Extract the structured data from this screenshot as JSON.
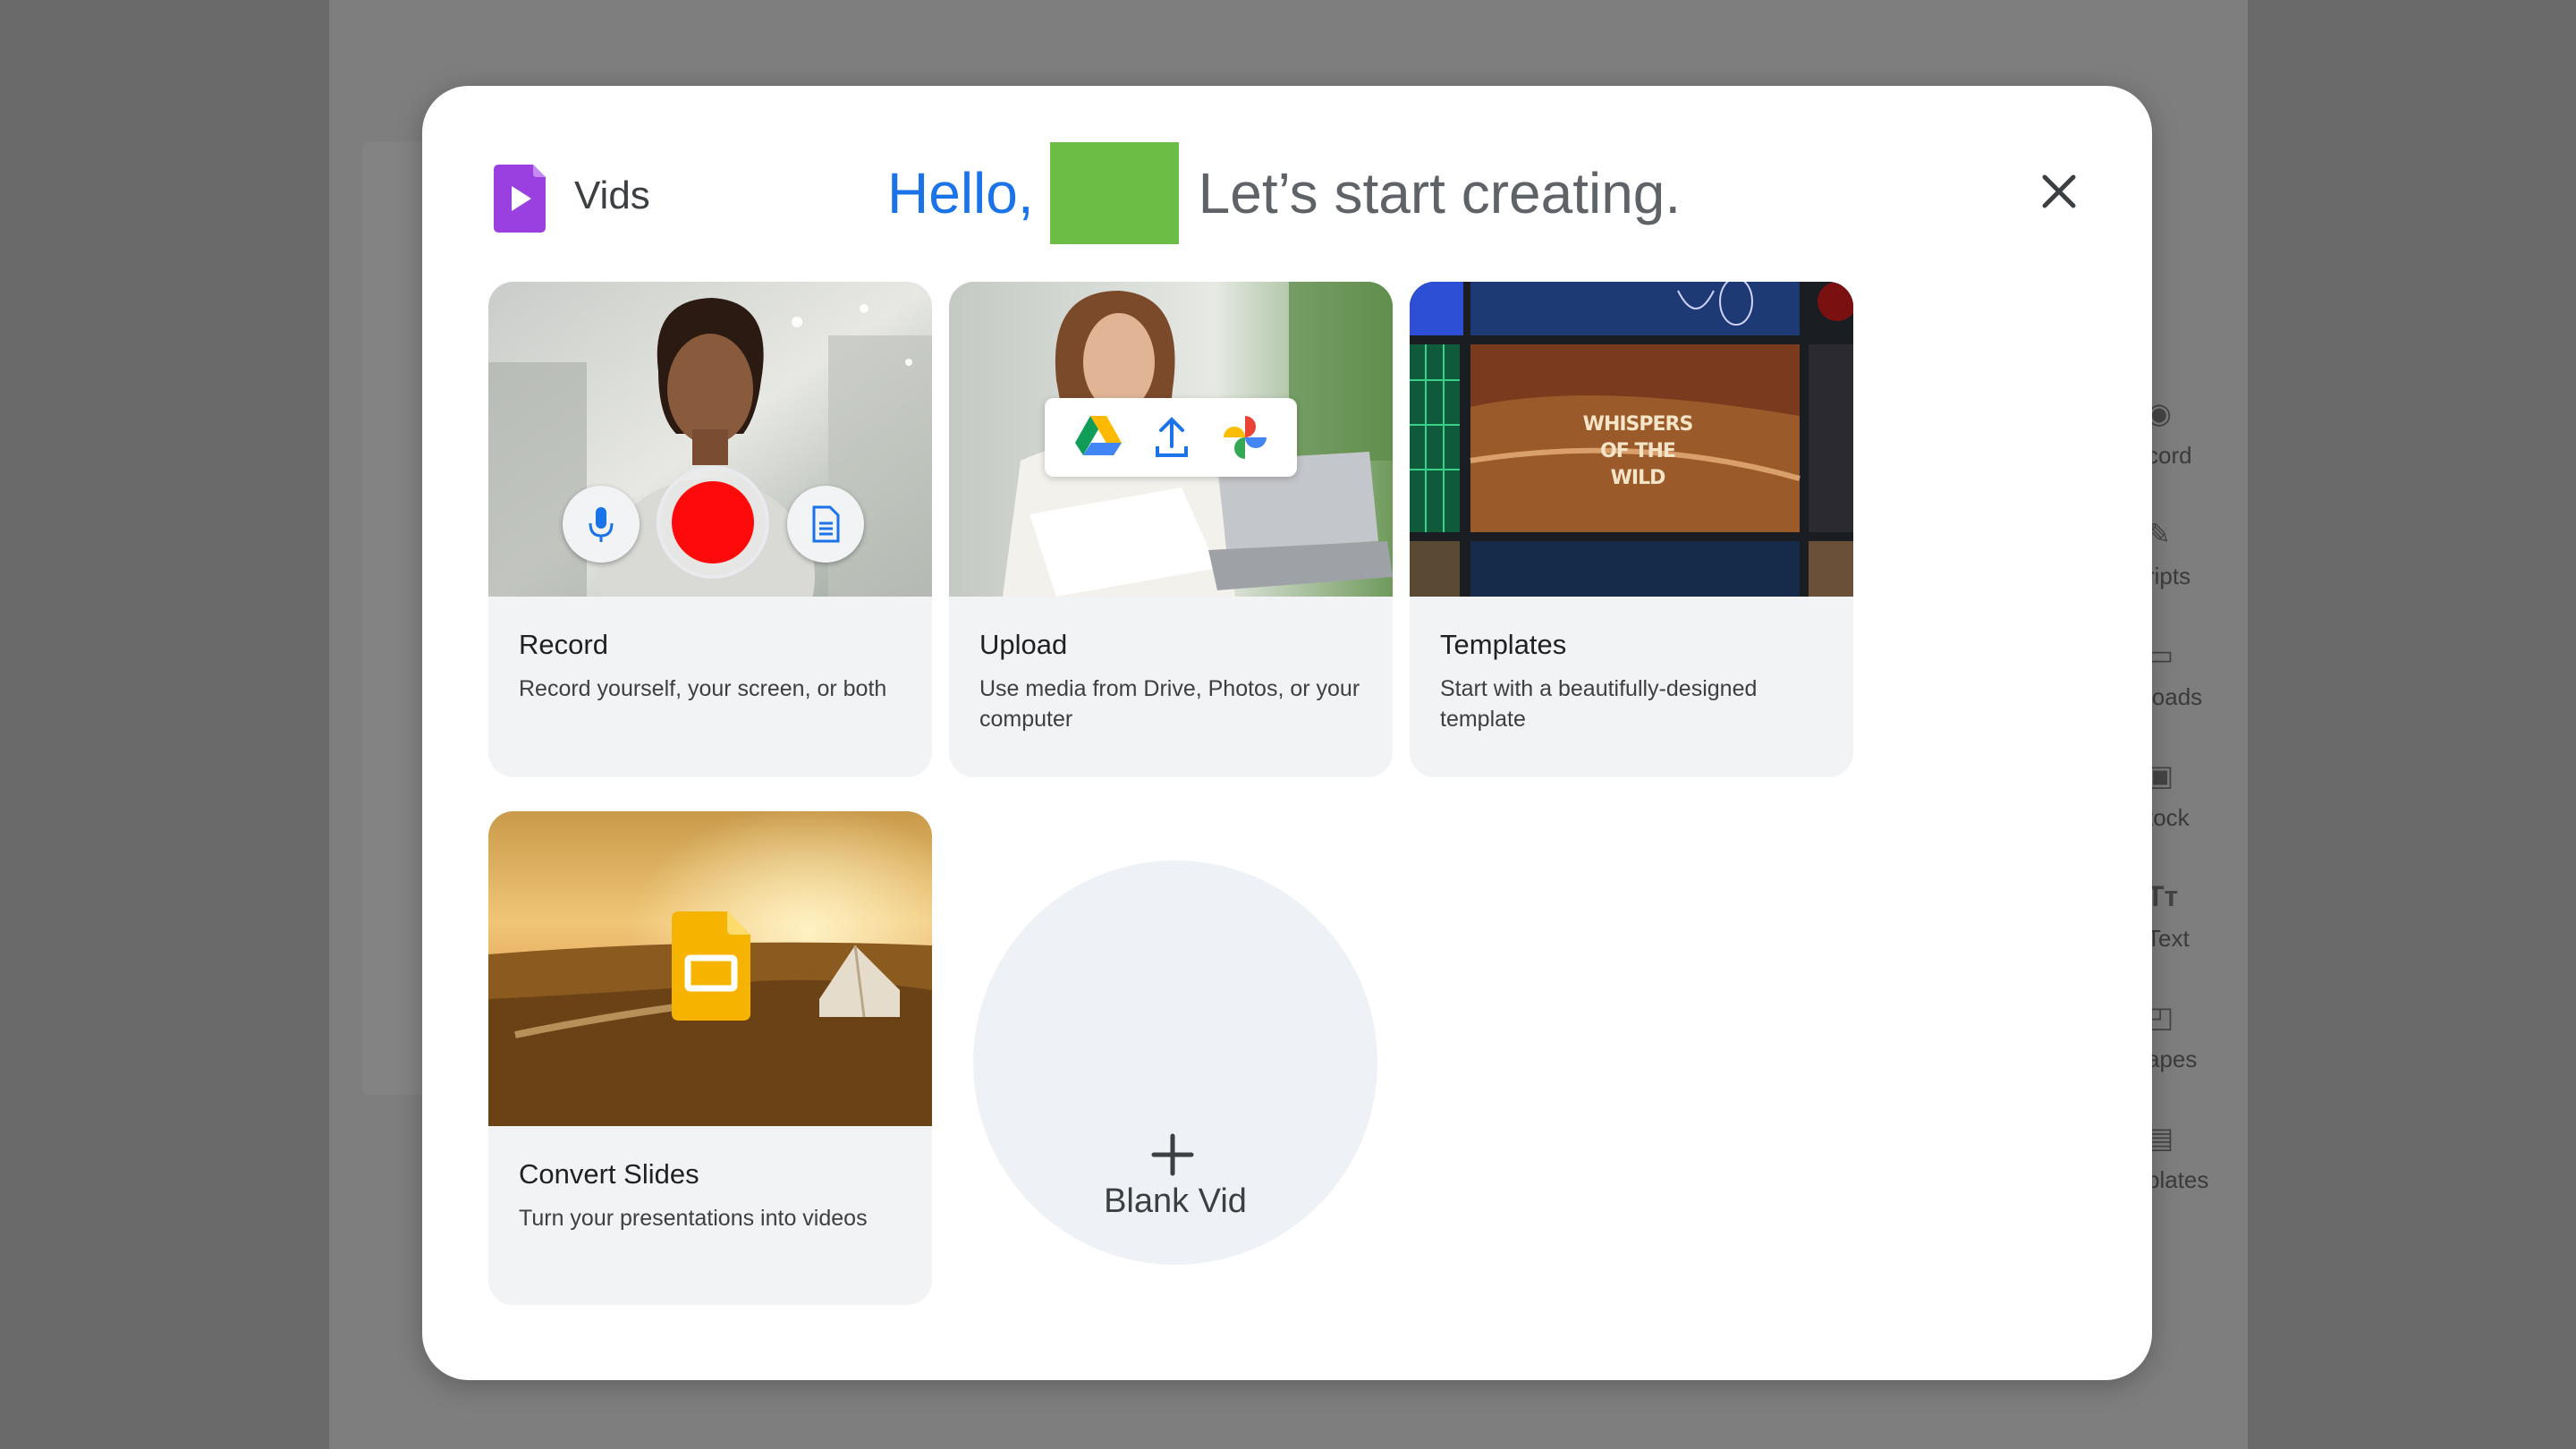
{
  "app": {
    "name": "Vids",
    "logo_icon": "vids-play-icon",
    "brand_color": "#8430ce"
  },
  "greeting": {
    "hello": "Hello,",
    "tagline": "Let’s start creating.",
    "hello_color": "#1a73e8",
    "avatar_color": "#6cbd45"
  },
  "close": {
    "icon": "close-icon"
  },
  "cards": [
    {
      "title": "Record",
      "description": "Record yourself, your screen, or both"
    },
    {
      "title": "Upload",
      "description": "Use media from Drive, Photos, or your computer"
    },
    {
      "title": "Templates",
      "description": "Start with a beautifully-designed template",
      "thumbnail_text": "WHISPERS OF THE WILD"
    },
    {
      "title": "Convert Slides",
      "description": "Turn your presentations into videos"
    }
  ],
  "blank_vid": {
    "label": "Blank Vid",
    "icon": "plus-icon"
  },
  "background_rail": {
    "items": [
      {
        "label": "cord",
        "icon": "record-icon"
      },
      {
        "label": "ripts",
        "icon": "script-icon"
      },
      {
        "label": "loads",
        "icon": "folder-icon"
      },
      {
        "label": "tock",
        "icon": "stock-icon"
      },
      {
        "label": "Text",
        "icon": "text-icon"
      },
      {
        "label": "apes",
        "icon": "shapes-icon"
      },
      {
        "label": "plates",
        "icon": "templates-icon"
      }
    ]
  }
}
